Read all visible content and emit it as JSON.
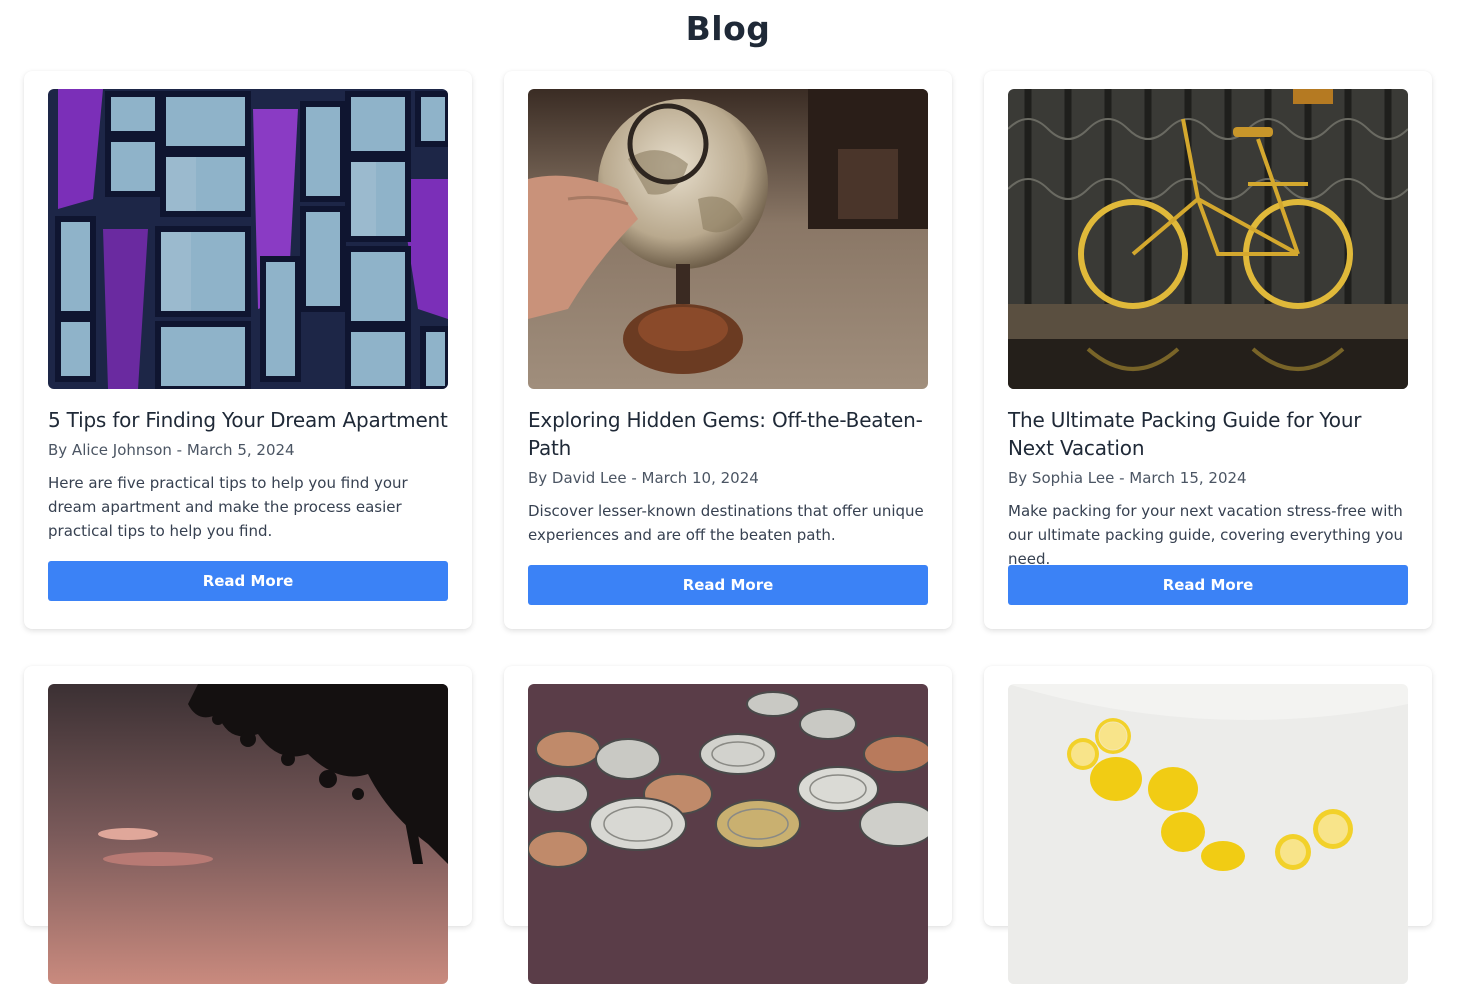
{
  "page": {
    "title": "Blog"
  },
  "posts": [
    {
      "title": "5 Tips for Finding Your Dream Apartment",
      "meta": "By Alice Johnson - March 5, 2024",
      "excerpt": "Here are five practical tips to help you find your dream apartment and make the process easier practical tips to help you find.",
      "button_label": "Read More"
    },
    {
      "title": "Exploring Hidden Gems: Off-the-Beaten-Path",
      "meta": "By David Lee - March 10, 2024",
      "excerpt": "Discover lesser-known destinations that offer unique experiences and are off the beaten path.",
      "button_label": "Read More"
    },
    {
      "title": "The Ultimate Packing Guide for Your Next Vacation",
      "meta": "By Sophia Lee - March 15, 2024",
      "excerpt": "Make packing for your next vacation stress-free with our ultimate packing guide, covering everything you need.",
      "button_label": "Read More"
    }
  ],
  "colors": {
    "accent": "#3b82f6",
    "title": "#1f2937",
    "meta": "#4b5563"
  }
}
